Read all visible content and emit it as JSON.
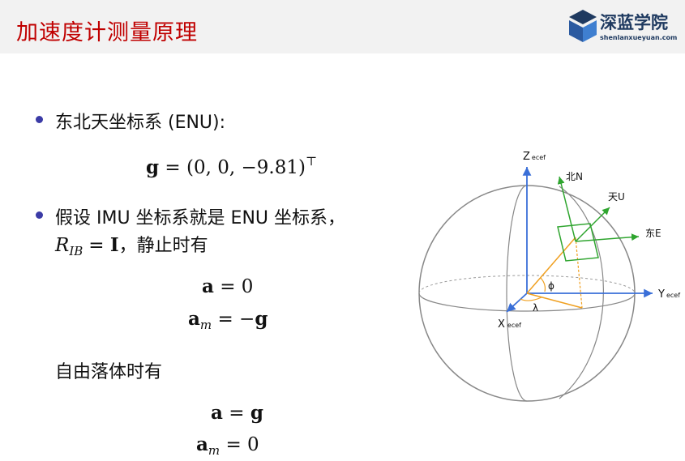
{
  "header": {
    "title": "加速度计测量原理",
    "logo_name": "深蓝学院",
    "logo_url": "shenlanxueyuan.com"
  },
  "bullets": [
    {
      "text": "东北天坐标系 (ENU):"
    },
    {
      "line1": "假设 IMU 坐标系就是 ENU 坐标系，",
      "line2_suffix": "，静止时有"
    }
  ],
  "equations": {
    "gravity": {
      "lhs": "g",
      "rhs": "= (0, 0, −9.81)",
      "sup": "⊤"
    },
    "rib": {
      "R": "R",
      "sub": "IB",
      "rhs": "= ",
      "I": "I"
    },
    "static_a": {
      "lhs": "a",
      "rhs": " = 0"
    },
    "static_am": {
      "lhs": "a",
      "sub": "m",
      "rhs": " = −",
      "g": "g"
    },
    "freefall_heading": "自由落体时有",
    "fall_a": {
      "lhs": "a",
      "rhs": " = ",
      "g": "g"
    },
    "fall_am": {
      "lhs": "a",
      "sub": "m",
      "rhs": " = 0"
    }
  },
  "diagram": {
    "z_label": "Z",
    "z_sub": "ecef",
    "y_label": "Y",
    "y_sub": "ecef",
    "x_label": "X",
    "x_sub": "ecef",
    "north": "北N",
    "up": "天U",
    "east": "东E",
    "phi": "ϕ",
    "lambda": "λ",
    "colors": {
      "axis": "#3a6fd8",
      "enu": "#2fa52f",
      "angle": "#f0a020",
      "sphere": "#888888"
    }
  }
}
